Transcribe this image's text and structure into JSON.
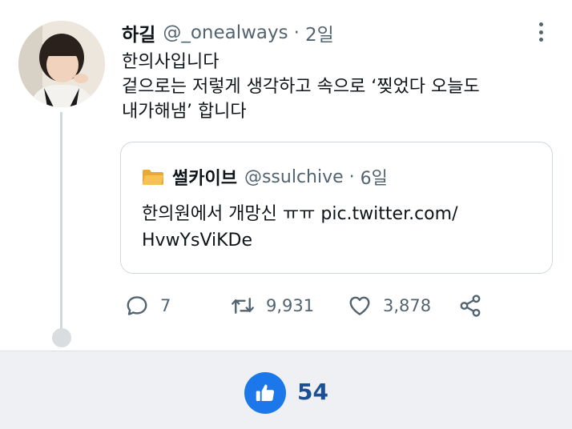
{
  "tweet": {
    "author": {
      "name": "하길",
      "handle": "@_onealways",
      "separator": "·",
      "time": "2일"
    },
    "text_lines": [
      "한의사입니다",
      "겉으로는 저렇게 생각하고 속으로 ‘찢었다 오늘도",
      "내가해냄’ 합니다"
    ],
    "quote": {
      "name": "썰카이브",
      "handle": "@ssulchive",
      "separator": "·",
      "time": "6일",
      "text_lines": [
        "한의원에서 개망신 ㅠㅠ pic.twitter.com/",
        "HvwYsViKDe"
      ]
    },
    "actions": {
      "replies": "7",
      "retweets": "9,931",
      "likes": "3,878"
    }
  },
  "footer": {
    "like_count": "54"
  },
  "colors": {
    "secondary_text": "#536471",
    "like_button": "#1b77ea",
    "like_count": "#1d4f94",
    "footer_bg": "#eef0f4"
  },
  "icons": [
    "more-options-icon",
    "folder-icon",
    "reply-icon",
    "retweet-icon",
    "heart-icon",
    "share-icon",
    "thumbs-up-icon"
  ]
}
